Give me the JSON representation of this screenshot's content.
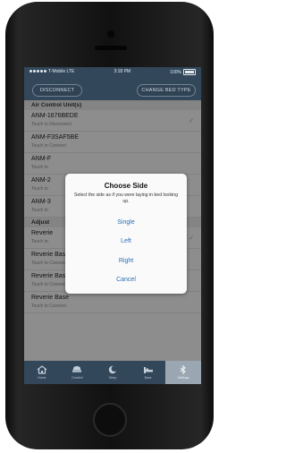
{
  "status": {
    "carrier": "T-Mobile LTE",
    "time": "3:18 PM",
    "battery": "100%"
  },
  "topbar": {
    "disconnect_label": "DISCONNECT",
    "change_bed_label": "CHANGE BED TYPE"
  },
  "sections": {
    "air_control": "Air Control Unit(s)",
    "adjustable": "Adjust"
  },
  "air_units": [
    {
      "name": "ANM-1676BEDE",
      "sub": "Touch to Disconnect",
      "connected": true
    },
    {
      "name": "ANM-F3SAF5BE",
      "sub": "Touch to Connect",
      "connected": false
    },
    {
      "name": "ANM-F",
      "sub": "Touch to",
      "connected": false
    },
    {
      "name": "ANM-2",
      "sub": "Touch to",
      "connected": false
    },
    {
      "name": "ANM-3",
      "sub": "Touch to",
      "connected": false
    }
  ],
  "bases": [
    {
      "name": "Reverie",
      "sub": "Touch to",
      "connected": true
    },
    {
      "name": "Reverie Base",
      "sub": "Touch to Connect",
      "connected": false
    },
    {
      "name": "Reverie Base",
      "sub": "Touch to Connect",
      "connected": false
    },
    {
      "name": "Reverie Base",
      "sub": "Touch to Connect",
      "connected": false
    }
  ],
  "dialog": {
    "title": "Choose Side",
    "message": "Select the side as if you were laying in bed looking up.",
    "options": [
      "Single",
      "Left",
      "Right"
    ],
    "cancel": "Cancel"
  },
  "tabs": [
    {
      "label": "Home",
      "icon": "home-icon"
    },
    {
      "label": "Comfort",
      "icon": "bed-sofa-icon"
    },
    {
      "label": "Sleep",
      "icon": "moon-icon"
    },
    {
      "label": "Base",
      "icon": "bed-icon"
    },
    {
      "label": "Settings",
      "icon": "bluetooth-icon"
    }
  ],
  "colors": {
    "header_bg": "#33475a",
    "accent_blue": "#2b6fb5",
    "active_tab": "#9aa7b3"
  }
}
